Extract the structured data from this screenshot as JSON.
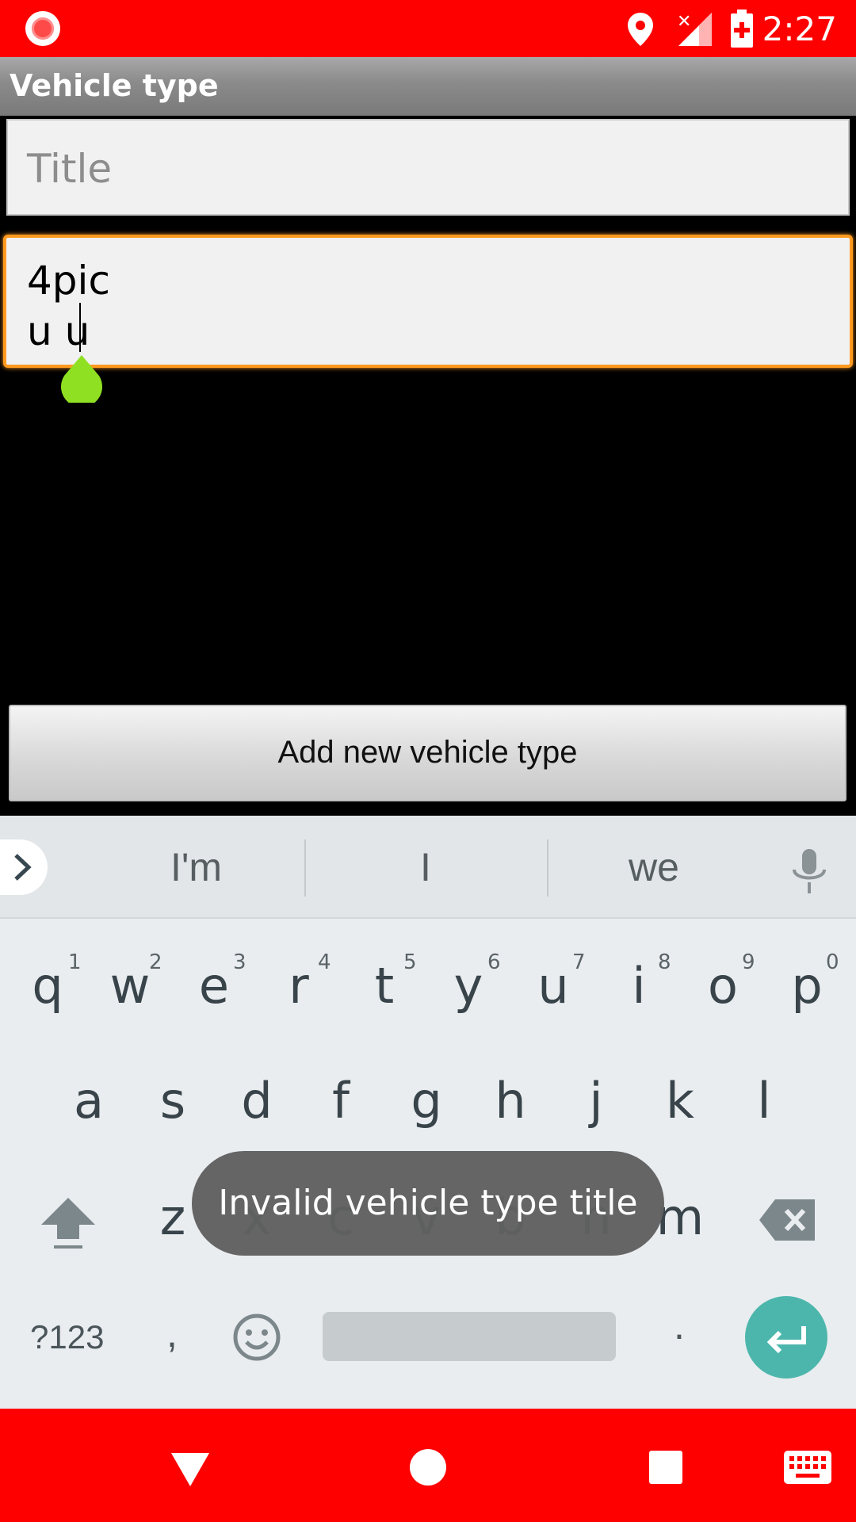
{
  "status_bar": {
    "time": "2:27",
    "icons": [
      "screen-record-icon",
      "location-icon",
      "signal-icon",
      "battery-charging-icon"
    ]
  },
  "action_bar": {
    "title": "Vehicle type"
  },
  "form": {
    "title_field": {
      "placeholder": "Title",
      "value": ""
    },
    "description_field": {
      "value": "4pic\nu u"
    },
    "add_button_label": "Add new vehicle type"
  },
  "keyboard": {
    "suggestions": [
      "I'm",
      "I",
      "we"
    ],
    "row1": [
      {
        "key": "q",
        "hint": "1"
      },
      {
        "key": "w",
        "hint": "2"
      },
      {
        "key": "e",
        "hint": "3"
      },
      {
        "key": "r",
        "hint": "4"
      },
      {
        "key": "t",
        "hint": "5"
      },
      {
        "key": "y",
        "hint": "6"
      },
      {
        "key": "u",
        "hint": "7"
      },
      {
        "key": "i",
        "hint": "8"
      },
      {
        "key": "o",
        "hint": "9"
      },
      {
        "key": "p",
        "hint": "0"
      }
    ],
    "row2": [
      "a",
      "s",
      "d",
      "f",
      "g",
      "h",
      "j",
      "k",
      "l"
    ],
    "row3": [
      "z",
      "x",
      "c",
      "v",
      "b",
      "n",
      "m"
    ],
    "symbols_label": "?123",
    "comma": ",",
    "period": "."
  },
  "toast": {
    "message": "Invalid vehicle type title"
  },
  "colors": {
    "status_bar": "#ff0000",
    "focus_border": "#ff9a1f",
    "selection_handle": "#8fe022",
    "enter_key": "#4db6ac"
  }
}
